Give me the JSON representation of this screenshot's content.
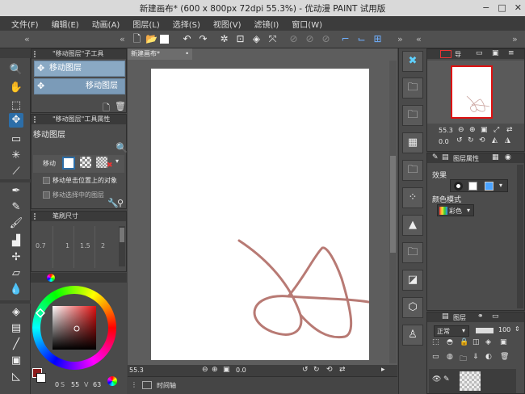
{
  "window": {
    "title": "新建画布* (600 x 800px 72dpi 55.3%) - 优动漫 PAINT 试用版",
    "buttons": [
      "−",
      "□",
      "✕"
    ]
  },
  "menu": [
    "文件(F)",
    "编辑(E)",
    "动画(A)",
    "图层(L)",
    "选择(S)",
    "视图(V)",
    "滤镜(I)",
    "窗口(W)"
  ],
  "subtool_panel": {
    "title": "\"移动图层\"子工具",
    "items": [
      "移动图层",
      "移动图层"
    ]
  },
  "tool_property": {
    "title": "\"移动图层\"工具属性",
    "tool_name": "移动图层",
    "move_label": "移动",
    "options": [
      "移动单击位置上的对象",
      "移动选择中的图层"
    ]
  },
  "brush_size": {
    "title": "笔刷尺寸",
    "sizes": [
      "0.7",
      "1",
      "1.5",
      "2"
    ]
  },
  "color": {
    "main_color": "#8b1a1a",
    "values": [
      "0",
      "55",
      "63"
    ]
  },
  "canvas": {
    "tab_label": "新建画布*",
    "zoom": "55.3",
    "angle": "0.0"
  },
  "timeline": {
    "label": "时间轴"
  },
  "navigator": {
    "tab_label": "导",
    "zoom": "55.3"
  },
  "layer_property": {
    "tab_label": "图层属性",
    "angle": "0.0",
    "effect_label": "效果",
    "color_mode_label": "颜色模式",
    "color_mode_value": "彩色"
  },
  "layer_panel": {
    "tab_label": "图层",
    "blend_mode": "正常",
    "opacity": "100"
  },
  "colors": {
    "stroke": "#b87a74",
    "accent": "#2c6ea8"
  }
}
